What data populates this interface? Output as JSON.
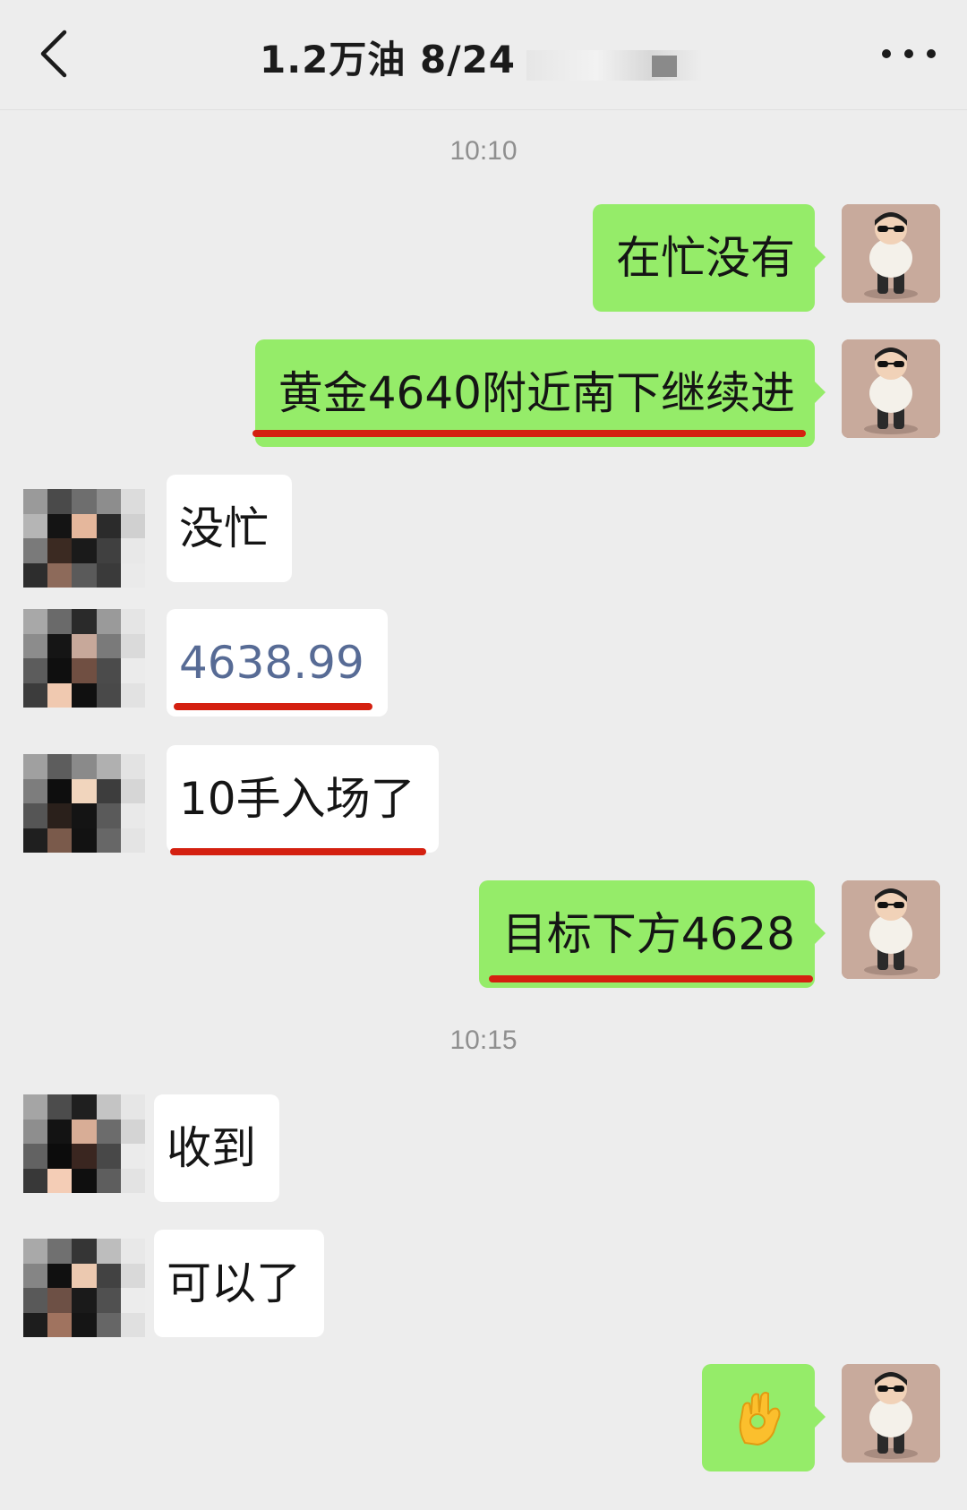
{
  "header": {
    "title": "1.2万油  8/24",
    "back_icon": "chevron-left-icon",
    "more_icon": "more-dots-icon"
  },
  "timestamps": [
    "10:10",
    "10:15"
  ],
  "messages": [
    {
      "side": "right",
      "text": "在忙没有"
    },
    {
      "side": "right",
      "text": "黄金4640附近南下继续进",
      "underlined": true
    },
    {
      "side": "left",
      "text": "没忙"
    },
    {
      "side": "left",
      "text": "4638.99",
      "underlined": true,
      "style": "link"
    },
    {
      "side": "left",
      "text": "10手入场了",
      "underlined": true
    },
    {
      "side": "right",
      "text": "目标下方4628",
      "underlined": true
    },
    {
      "side": "left",
      "text": "收到"
    },
    {
      "side": "left",
      "text": "可以了"
    },
    {
      "side": "right",
      "emoji": "ok-hand-emoji"
    }
  ],
  "colors": {
    "background": "#ededed",
    "bubble_self": "#95ec69",
    "bubble_other": "#ffffff",
    "underline": "#d42010",
    "link_text": "#576b95",
    "timestamp": "#8f8f8f"
  }
}
